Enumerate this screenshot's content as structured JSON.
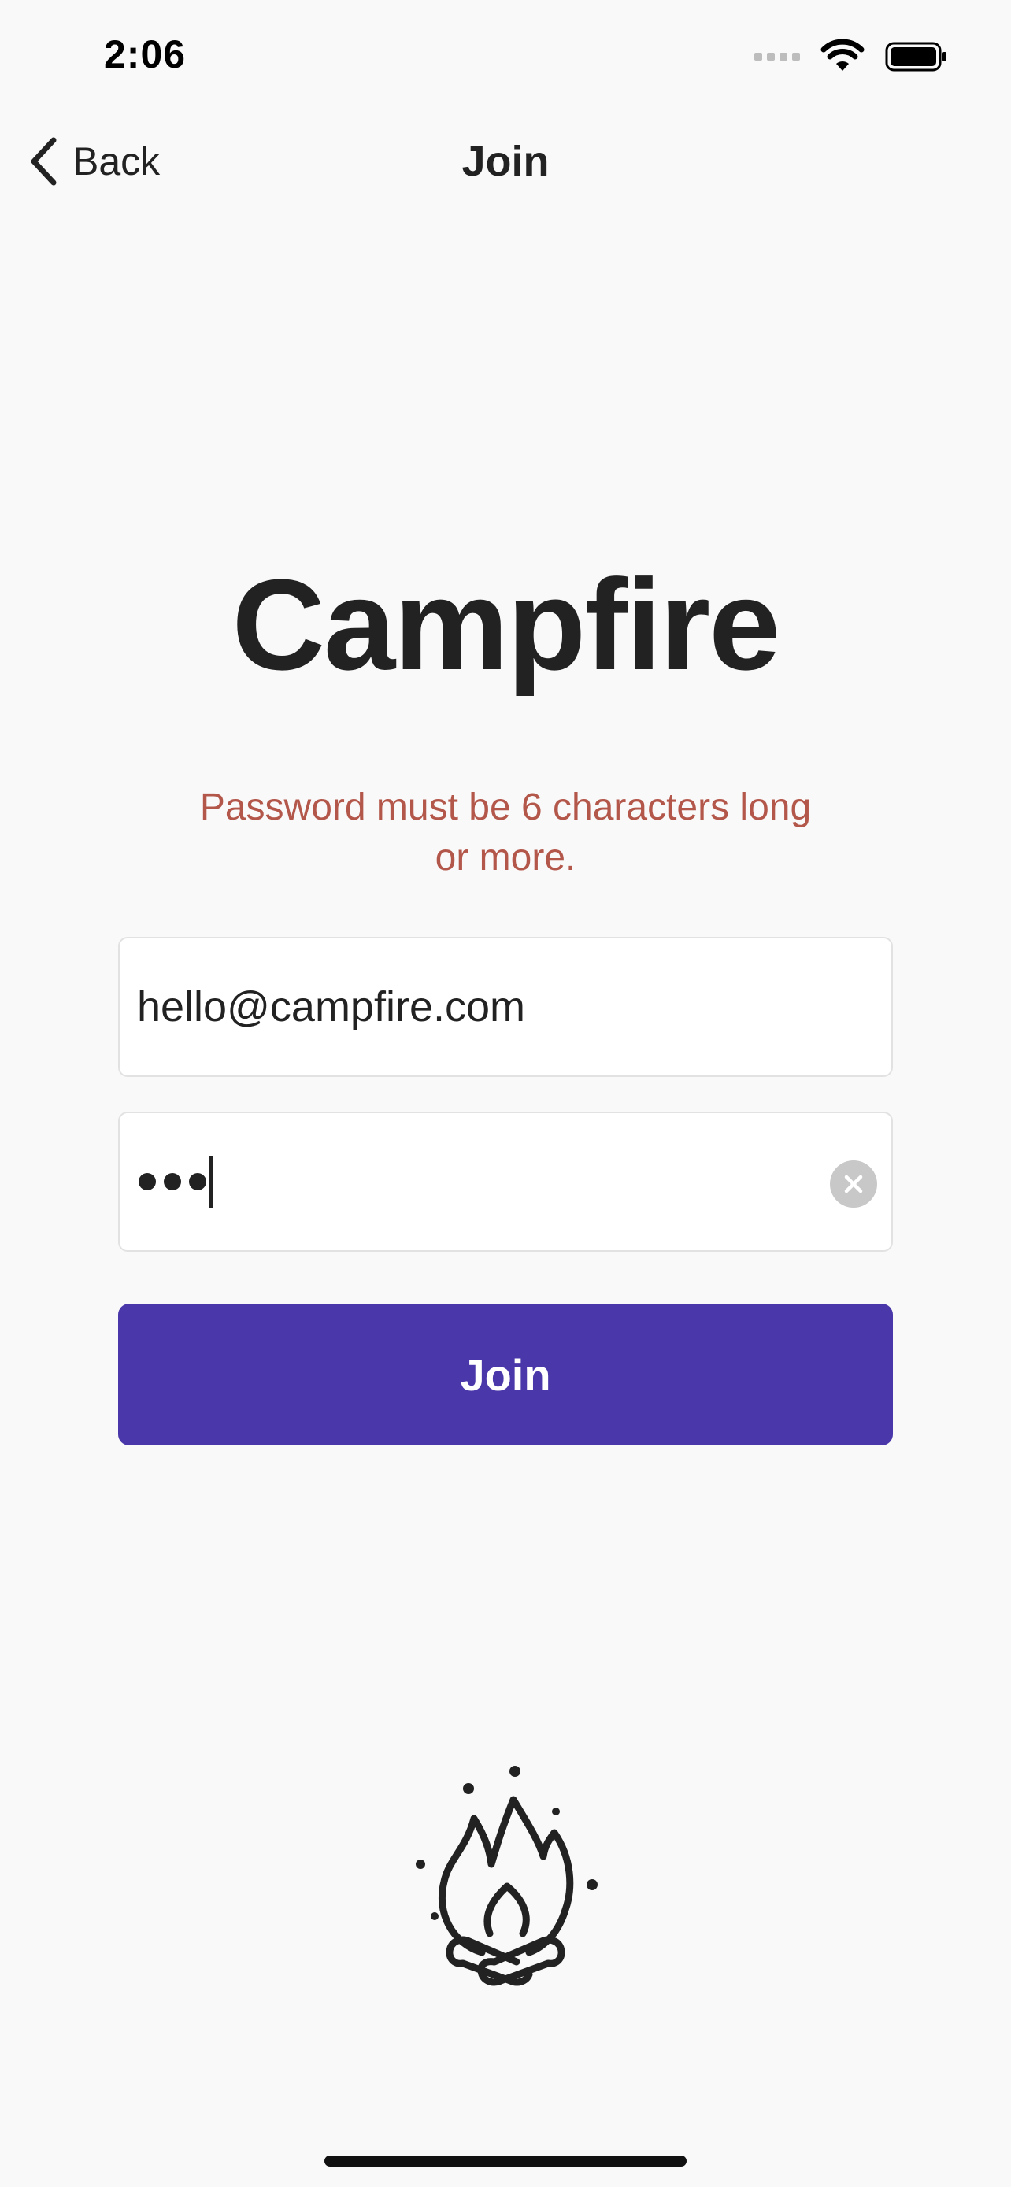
{
  "status_bar": {
    "time": "2:06",
    "signal_icon": "cellular-signal-icon",
    "wifi_icon": "wifi-icon",
    "battery_icon": "battery-icon"
  },
  "nav": {
    "back_label": "Back",
    "back_icon": "chevron-left-icon",
    "title": "Join"
  },
  "app": {
    "name": "Campfire"
  },
  "form": {
    "error_message": "Password must be 6 characters long or more.",
    "email_value": "hello@campfire.com",
    "password_masked_length": 3,
    "clear_icon": "clear-circle-icon",
    "submit_label": "Join"
  },
  "illustration": {
    "icon": "campfire-icon"
  },
  "colors": {
    "accent": "#4a38aa",
    "error": "#b4574b",
    "text": "#222222",
    "background": "#f9f9f9"
  }
}
